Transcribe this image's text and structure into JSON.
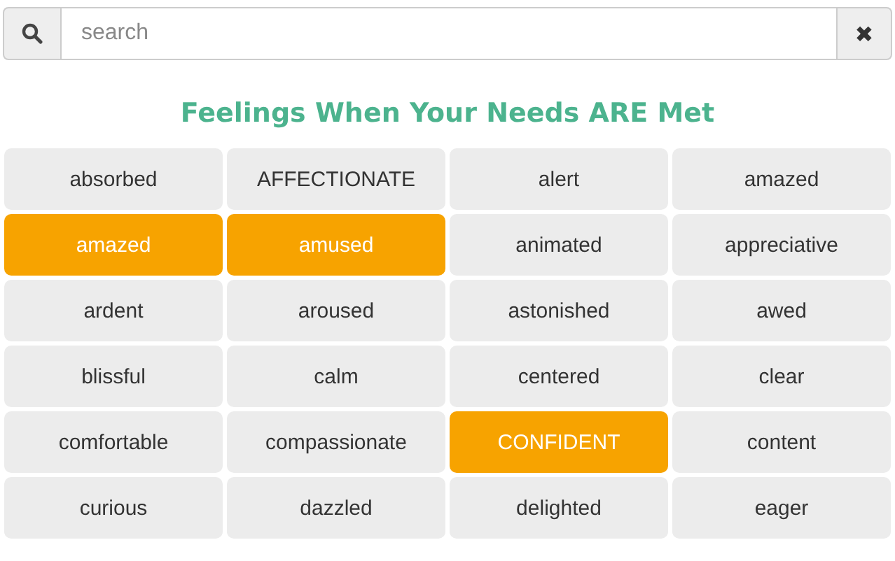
{
  "search": {
    "placeholder": "search"
  },
  "clear_button": {
    "label": "✖"
  },
  "heading": "Feelings When Your Needs ARE Met",
  "feelings": [
    {
      "label": "absorbed",
      "selected": false
    },
    {
      "label": "AFFECTIONATE",
      "selected": false
    },
    {
      "label": "alert",
      "selected": false
    },
    {
      "label": "amazed",
      "selected": false
    },
    {
      "label": "amazed",
      "selected": true
    },
    {
      "label": "amused",
      "selected": true
    },
    {
      "label": "animated",
      "selected": false
    },
    {
      "label": "appreciative",
      "selected": false
    },
    {
      "label": "ardent",
      "selected": false
    },
    {
      "label": "aroused",
      "selected": false
    },
    {
      "label": "astonished",
      "selected": false
    },
    {
      "label": "awed",
      "selected": false
    },
    {
      "label": "blissful",
      "selected": false
    },
    {
      "label": "calm",
      "selected": false
    },
    {
      "label": "centered",
      "selected": false
    },
    {
      "label": "clear",
      "selected": false
    },
    {
      "label": "comfortable",
      "selected": false
    },
    {
      "label": "compassionate",
      "selected": false
    },
    {
      "label": "CONFIDENT",
      "selected": true
    },
    {
      "label": "content",
      "selected": false
    },
    {
      "label": "curious",
      "selected": false
    },
    {
      "label": "dazzled",
      "selected": false
    },
    {
      "label": "delighted",
      "selected": false
    },
    {
      "label": "eager",
      "selected": false
    }
  ]
}
